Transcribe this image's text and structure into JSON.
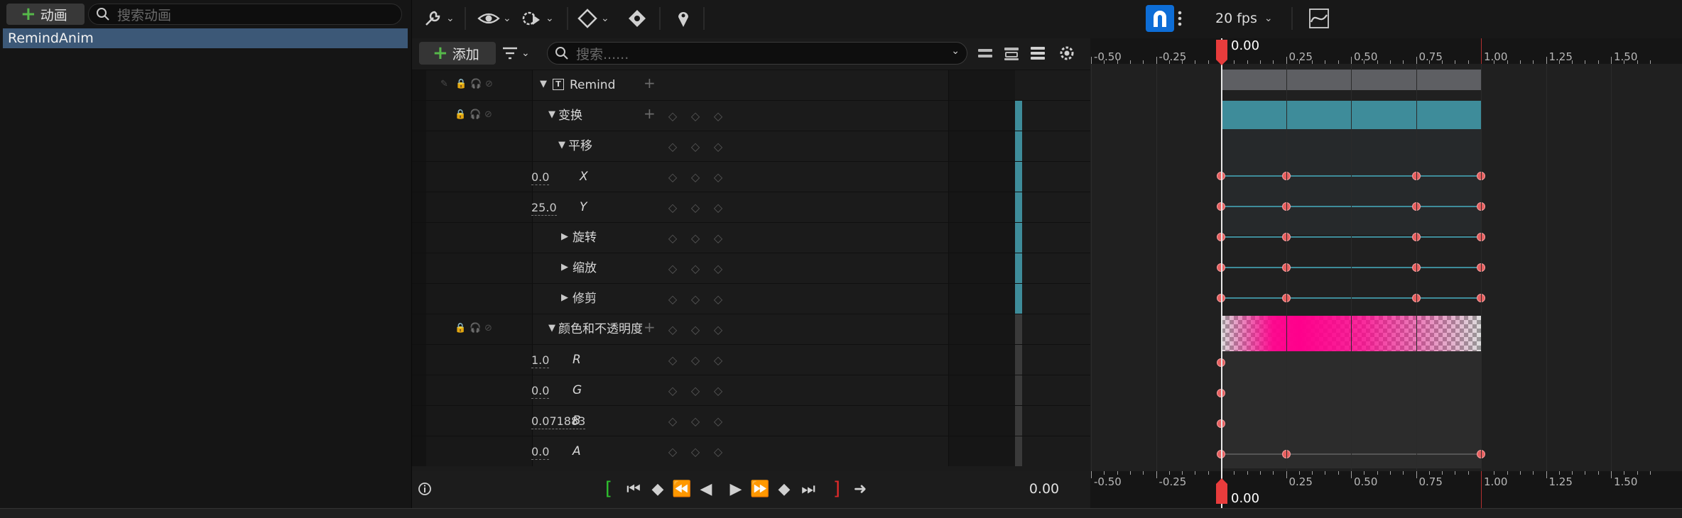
{
  "left_panel": {
    "add_button_label": "动画",
    "search_placeholder": "搜索动画",
    "animations": [
      "RemindAnim"
    ]
  },
  "toolbar": {
    "fps_label": "20 fps",
    "icons": [
      "wrench-icon",
      "eye-icon",
      "gear-play-icon",
      "diamond-key-icon",
      "auto-key-icon",
      "marker-icon",
      "magnet-snap-icon",
      "more-icon",
      "curve-editor-icon"
    ]
  },
  "tracks_panel": {
    "add_button_label": "添加",
    "search_placeholder": "搜索......",
    "rows": [
      {
        "label": "Remind",
        "value": "",
        "indent": 1
      },
      {
        "label": "变换",
        "value": "",
        "indent": 2
      },
      {
        "label": "平移",
        "value": "",
        "indent": 3
      },
      {
        "label": "X",
        "value": "0.0",
        "indent": 4
      },
      {
        "label": "Y",
        "value": "25.0",
        "indent": 4
      },
      {
        "label": "旋转",
        "value": "",
        "indent": 3
      },
      {
        "label": "缩放",
        "value": "",
        "indent": 3
      },
      {
        "label": "修剪",
        "value": "",
        "indent": 3
      },
      {
        "label": "颜色和不透明度",
        "value": "",
        "indent": 2
      },
      {
        "label": "R",
        "value": "1.0",
        "indent": 4
      },
      {
        "label": "G",
        "value": "0.0",
        "indent": 4
      },
      {
        "label": "B",
        "value": "0.071883",
        "indent": 4
      },
      {
        "label": "A",
        "value": "0.0",
        "indent": 4
      }
    ]
  },
  "timeline": {
    "playhead_top": "0.00",
    "playhead_bottom": "0.00",
    "ruler_labels": [
      "-0.50",
      "-0.25",
      "0.25",
      "0.50",
      "0.75",
      "1.00",
      "1.25",
      "1.50"
    ],
    "range": {
      "start": 0.0,
      "end": 1.0
    },
    "keyframes_full": [
      0.0,
      0.25,
      0.75,
      1.0
    ]
  },
  "transport": {
    "current_time": "0.00"
  },
  "colors": {
    "accent": "#0d6dd6",
    "track_teal": "#3e8c9a",
    "key_red": "#e86060",
    "playhead": "#e83c3c",
    "selection": "#3c5877"
  }
}
